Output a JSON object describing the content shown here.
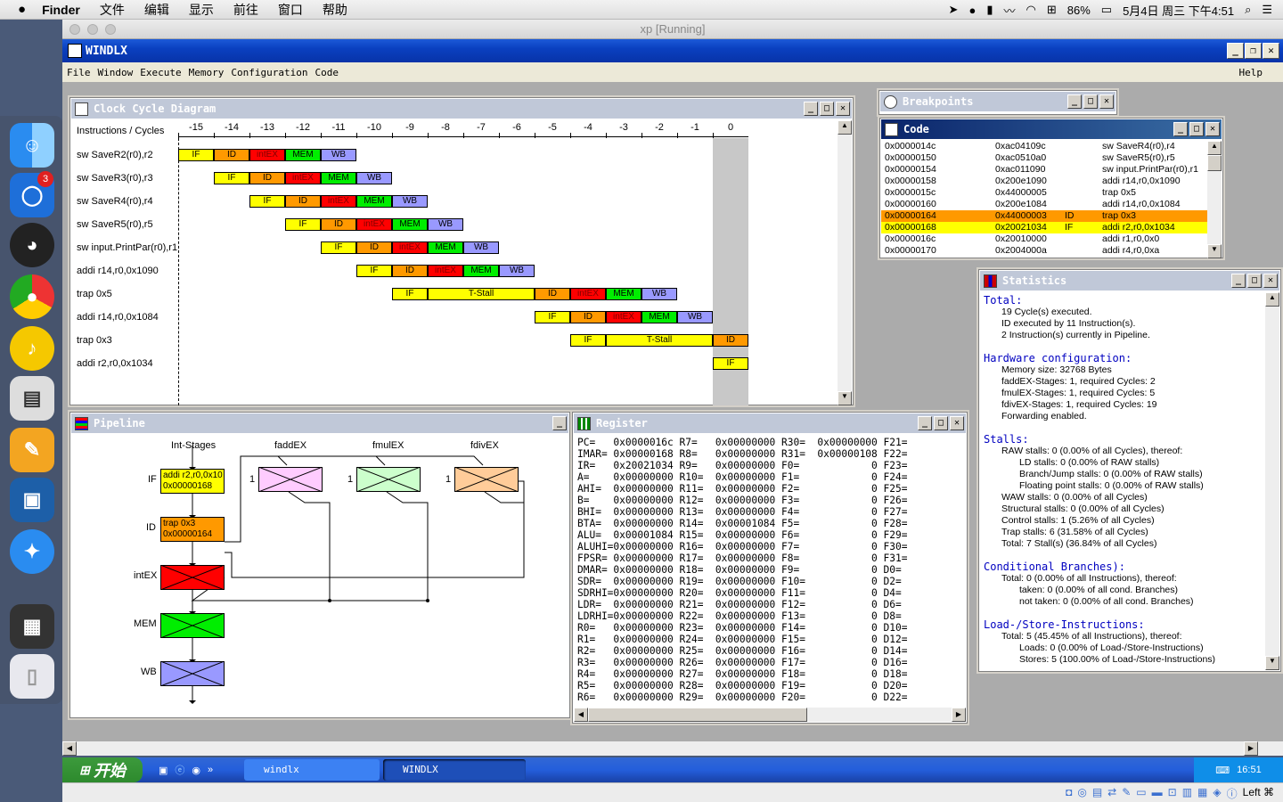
{
  "mac": {
    "apple": "",
    "app": "Finder",
    "menus": [
      "文件",
      "编辑",
      "显示",
      "前往",
      "窗口",
      "帮助"
    ],
    "battery": "86%",
    "clock": "5月4日 周三 下午4:51"
  },
  "dock": {
    "badge": "3"
  },
  "vm": {
    "title": "xp [Running]"
  },
  "app": {
    "title": "WINDLX",
    "menus": [
      "File",
      "Window",
      "Execute",
      "Memory",
      "Configuration",
      "Code"
    ],
    "help": "Help"
  },
  "clock": {
    "title": "Clock Cycle Diagram",
    "header": "Instructions / Cycles",
    "ticks": [
      "-15",
      "-14",
      "-13",
      "-12",
      "-11",
      "-10",
      "-9",
      "-8",
      "-7",
      "-6",
      "-5",
      "-4",
      "-3",
      "-2",
      "-1",
      "0"
    ],
    "rows": [
      {
        "label": "sw SaveR2(r0),r2",
        "stages": [
          [
            "IF",
            0
          ],
          [
            "ID",
            1
          ],
          [
            "intEX",
            2
          ],
          [
            "MEM",
            3
          ],
          [
            "WB",
            4
          ]
        ]
      },
      {
        "label": "sw SaveR3(r0),r3",
        "stages": [
          [
            "IF",
            1
          ],
          [
            "ID",
            2
          ],
          [
            "intEX",
            3
          ],
          [
            "MEM",
            4
          ],
          [
            "WB",
            5
          ]
        ]
      },
      {
        "label": "sw SaveR4(r0),r4",
        "stages": [
          [
            "IF",
            2
          ],
          [
            "ID",
            3
          ],
          [
            "intEX",
            4
          ],
          [
            "MEM",
            5
          ],
          [
            "WB",
            6
          ]
        ]
      },
      {
        "label": "sw SaveR5(r0),r5",
        "stages": [
          [
            "IF",
            3
          ],
          [
            "ID",
            4
          ],
          [
            "intEX",
            5
          ],
          [
            "MEM",
            6
          ],
          [
            "WB",
            7
          ]
        ]
      },
      {
        "label": "sw input.PrintPar(r0),r1",
        "stages": [
          [
            "IF",
            4
          ],
          [
            "ID",
            5
          ],
          [
            "intEX",
            6
          ],
          [
            "MEM",
            7
          ],
          [
            "WB",
            8
          ]
        ]
      },
      {
        "label": "addi r14,r0,0x1090",
        "stages": [
          [
            "IF",
            5
          ],
          [
            "ID",
            6
          ],
          [
            "intEX",
            7
          ],
          [
            "MEM",
            8
          ],
          [
            "WB",
            9
          ]
        ]
      },
      {
        "label": "trap 0x5",
        "stages": [
          [
            "IF",
            6
          ],
          [
            "T-Stall",
            7,
            3
          ],
          [
            "ID",
            10
          ],
          [
            "intEX",
            11
          ],
          [
            "MEM",
            12
          ],
          [
            "WB",
            13
          ]
        ]
      },
      {
        "label": "addi r14,r0,0x1084",
        "stages": [
          [
            "IF",
            10
          ],
          [
            "ID",
            11
          ],
          [
            "intEX",
            12
          ],
          [
            "MEM",
            13
          ],
          [
            "WB",
            14
          ]
        ]
      },
      {
        "label": "trap 0x3",
        "stages": [
          [
            "IF",
            11
          ],
          [
            "T-Stall",
            12,
            3
          ],
          [
            "ID",
            15
          ]
        ]
      },
      {
        "label": "addi r2,r0,0x1034",
        "stages": [
          [
            "IF",
            15
          ]
        ]
      }
    ]
  },
  "breakpoints": {
    "title": "Breakpoints"
  },
  "code": {
    "title": "Code",
    "rows": [
      [
        "0x0000014c",
        "0xac04109c",
        "",
        "sw SaveR4(r0),r4",
        ""
      ],
      [
        "0x00000150",
        "0xac0510a0",
        "",
        "sw SaveR5(r0),r5",
        ""
      ],
      [
        "0x00000154",
        "0xac011090",
        "",
        "sw input.PrintPar(r0),r1",
        ""
      ],
      [
        "0x00000158",
        "0x200e1090",
        "",
        "addi r14,r0,0x1090",
        ""
      ],
      [
        "0x0000015c",
        "0x44000005",
        "",
        "trap 0x5",
        ""
      ],
      [
        "0x00000160",
        "0x200e1084",
        "",
        "addi r14,r0,0x1084",
        ""
      ],
      [
        "0x00000164",
        "0x44000003",
        "ID",
        "trap 0x3",
        "#ff9900"
      ],
      [
        "0x00000168",
        "0x20021034",
        "IF",
        "addi r2,r0,0x1034",
        "#ffff00"
      ],
      [
        "0x0000016c",
        "0x20010000",
        "",
        "addi r1,r0,0x0",
        ""
      ],
      [
        "0x00000170",
        "0x2004000a",
        "",
        "addi r4,r0,0xa",
        ""
      ]
    ]
  },
  "pipeline": {
    "title": "Pipeline",
    "int_stages": "Int-Stages",
    "fadd": "faddEX",
    "fmul": "fmulEX",
    "fdiv": "fdivEX",
    "if_label": "IF",
    "id_label": "ID",
    "intex_label": "intEX",
    "mem_label": "MEM",
    "wb_label": "WB",
    "if_text1": "addi r2,r0,0x10",
    "if_text2": "0x00000168",
    "id_text1": "trap 0x3",
    "id_text2": "0x00000164",
    "one": "1"
  },
  "register": {
    "title": "Register",
    "lines": [
      "PC=   0x0000016c R7=   0x00000000 R30=  0x00000000 F21=",
      "IMAR= 0x00000168 R8=   0x00000000 R31=  0x00000108 F22=",
      "IR=   0x20021034 R9=   0x00000000 F0=            0 F23=",
      "A=    0x00000000 R10=  0x00000000 F1=            0 F24=",
      "AHI=  0x00000000 R11=  0x00000000 F2=            0 F25=",
      "B=    0x00000000 R12=  0x00000000 F3=            0 F26=",
      "BHI=  0x00000000 R13=  0x00000000 F4=            0 F27=",
      "BTA=  0x00000000 R14=  0x00001084 F5=            0 F28=",
      "ALU=  0x00001084 R15=  0x00000000 F6=            0 F29=",
      "ALUHI=0x00000000 R16=  0x00000000 F7=            0 F30=",
      "FPSR= 0x00000000 R17=  0x00000000 F8=            0 F31=",
      "DMAR= 0x00000000 R18=  0x00000000 F9=            0 D0=",
      "SDR=  0x00000000 R19=  0x00000000 F10=           0 D2=",
      "SDRHI=0x00000000 R20=  0x00000000 F11=           0 D4=",
      "LDR=  0x00000000 R21=  0x00000000 F12=           0 D6=",
      "LDRHI=0x00000000 R22=  0x00000000 F13=           0 D8=",
      "R0=   0x00000000 R23=  0x00000000 F14=           0 D10=",
      "R1=   0x00000000 R24=  0x00000000 F15=           0 D12=",
      "R2=   0x00000000 R25=  0x00000000 F16=           0 D14=",
      "R3=   0x00000000 R26=  0x00000000 F17=           0 D16=",
      "R4=   0x00000000 R27=  0x00000000 F18=           0 D18=",
      "R5=   0x00000000 R28=  0x00000000 F19=           0 D20=",
      "R6=   0x00000000 R29=  0x00000000 F20=           0 D22="
    ]
  },
  "stats": {
    "title": "Statistics",
    "lines": [
      [
        "h",
        "Total:"
      ],
      [
        "l1",
        "19 Cycle(s) executed."
      ],
      [
        "l1",
        "ID executed by 11 Instruction(s)."
      ],
      [
        "l1",
        "2 Instruction(s) currently in Pipeline."
      ],
      [
        "sp",
        ""
      ],
      [
        "h",
        "Hardware configuration:"
      ],
      [
        "l2",
        "Memory size: 32768 Bytes"
      ],
      [
        "l2",
        "faddEX-Stages: 1, required Cycles: 2"
      ],
      [
        "l2",
        "fmulEX-Stages: 1, required Cycles: 5"
      ],
      [
        "l2",
        "fdivEX-Stages: 1, required Cycles: 19"
      ],
      [
        "l2",
        "Forwarding enabled."
      ],
      [
        "sp",
        ""
      ],
      [
        "h",
        "Stalls:"
      ],
      [
        "l2",
        "RAW stalls: 0 (0.00% of all Cycles), thereof:"
      ],
      [
        "l3",
        "LD stalls: 0 (0.00% of RAW stalls)"
      ],
      [
        "l3",
        "Branch/Jump stalls: 0 (0.00% of RAW stalls)"
      ],
      [
        "l3",
        "Floating point stalls: 0 (0.00% of RAW stalls)"
      ],
      [
        "l2",
        "WAW stalls: 0 (0.00% of all Cycles)"
      ],
      [
        "l2",
        "Structural stalls: 0 (0.00% of all Cycles)"
      ],
      [
        "l2",
        "Control stalls: 1 (5.26% of all Cycles)"
      ],
      [
        "l2",
        "Trap stalls: 6 (31.58% of all Cycles)"
      ],
      [
        "l2",
        "Total: 7 Stall(s) (36.84% of all Cycles)"
      ],
      [
        "sp",
        ""
      ],
      [
        "h",
        "Conditional Branches):"
      ],
      [
        "l2",
        "Total: 0 (0.00% of all Instructions), thereof:"
      ],
      [
        "l3",
        "taken: 0 (0.00% of all cond. Branches)"
      ],
      [
        "l3",
        "not taken: 0 (0.00% of all cond. Branches)"
      ],
      [
        "sp",
        ""
      ],
      [
        "h",
        "Load-/Store-Instructions:"
      ],
      [
        "l2",
        "Total: 5 (45.45% of all Instructions), thereof:"
      ],
      [
        "l3",
        "Loads: 0 (0.00% of Load-/Store-Instructions)"
      ],
      [
        "l3",
        "Stores: 5 (100.00% of Load-/Store-Instructions)"
      ]
    ]
  },
  "taskbar": {
    "start": "开始",
    "task1": "windlx",
    "task2": "WINDLX",
    "clock": "16:51",
    "arrows": "»"
  },
  "statusbar": {
    "hostkey": "Left ⌘"
  }
}
